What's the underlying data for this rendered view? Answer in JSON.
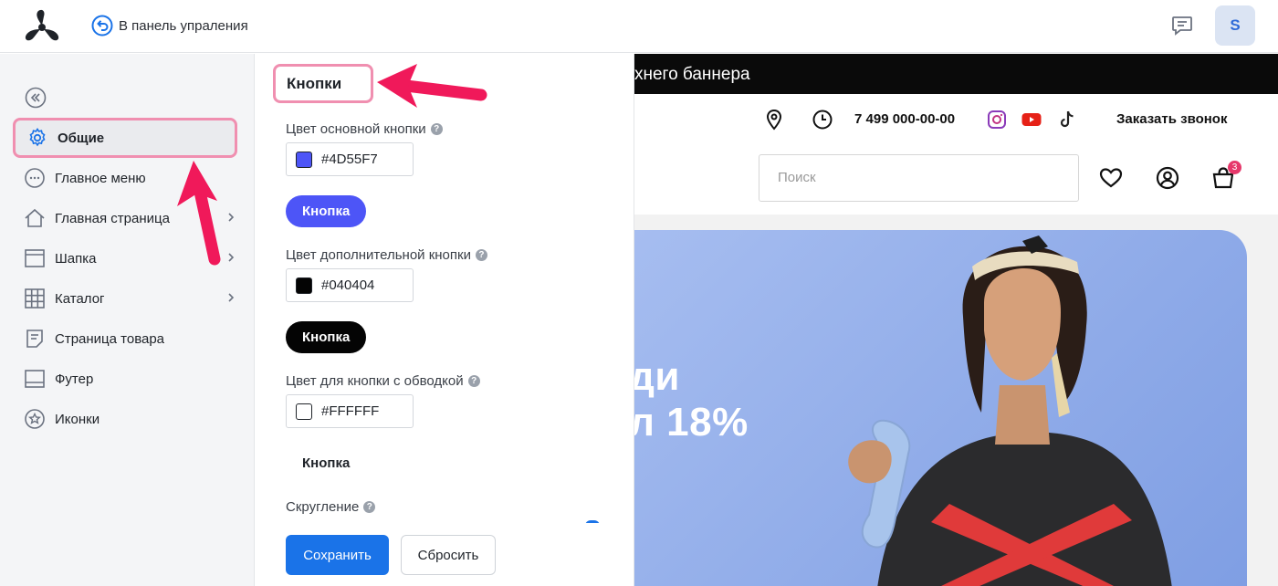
{
  "topbar": {
    "back_label": "В панель упраления",
    "avatar_letter": "S"
  },
  "sidebar": {
    "items": [
      {
        "label": "Общие",
        "icon": "gear-icon",
        "active": true,
        "has_chevron": false
      },
      {
        "label": "Главное меню",
        "icon": "dots-circle-icon",
        "active": false,
        "has_chevron": false
      },
      {
        "label": "Главная страница",
        "icon": "home-icon",
        "active": false,
        "has_chevron": true
      },
      {
        "label": "Шапка",
        "icon": "header-layout-icon",
        "active": false,
        "has_chevron": true
      },
      {
        "label": "Каталог",
        "icon": "grid-icon",
        "active": false,
        "has_chevron": true
      },
      {
        "label": "Страница товара",
        "icon": "document-icon",
        "active": false,
        "has_chevron": false
      },
      {
        "label": "Футер",
        "icon": "footer-layout-icon",
        "active": false,
        "has_chevron": false
      },
      {
        "label": "Иконки",
        "icon": "star-circle-icon",
        "active": false,
        "has_chevron": false
      }
    ]
  },
  "panel": {
    "title": "Кнопки",
    "primary": {
      "label": "Цвет основной кнопки",
      "value": "#4D55F7",
      "button_label": "Кнопка"
    },
    "secondary": {
      "label": "Цвет дополнительной кнопки",
      "value": "#040404",
      "button_label": "Кнопка"
    },
    "outline": {
      "label": "Цвет для кнопки с обводкой",
      "value": "#FFFFFF",
      "button_label": "Кнопка"
    },
    "rounding_label": "Скругление",
    "help": "?",
    "save_label": "Сохранить",
    "reset_label": "Сбросить"
  },
  "preview": {
    "promo_text": "хнего баннера",
    "phone": "7 499 000-00-00",
    "callback": "Заказать звонок",
    "search_placeholder": "Поиск",
    "cart_count": "3",
    "banner_line1": "ди",
    "banner_line2": "л 18%"
  },
  "colors": {
    "highlight": "#F08FB0",
    "arrow": "#F0195A",
    "accent": "#1A73E8",
    "primary_button": "#4D55F7",
    "secondary_button": "#040404"
  }
}
